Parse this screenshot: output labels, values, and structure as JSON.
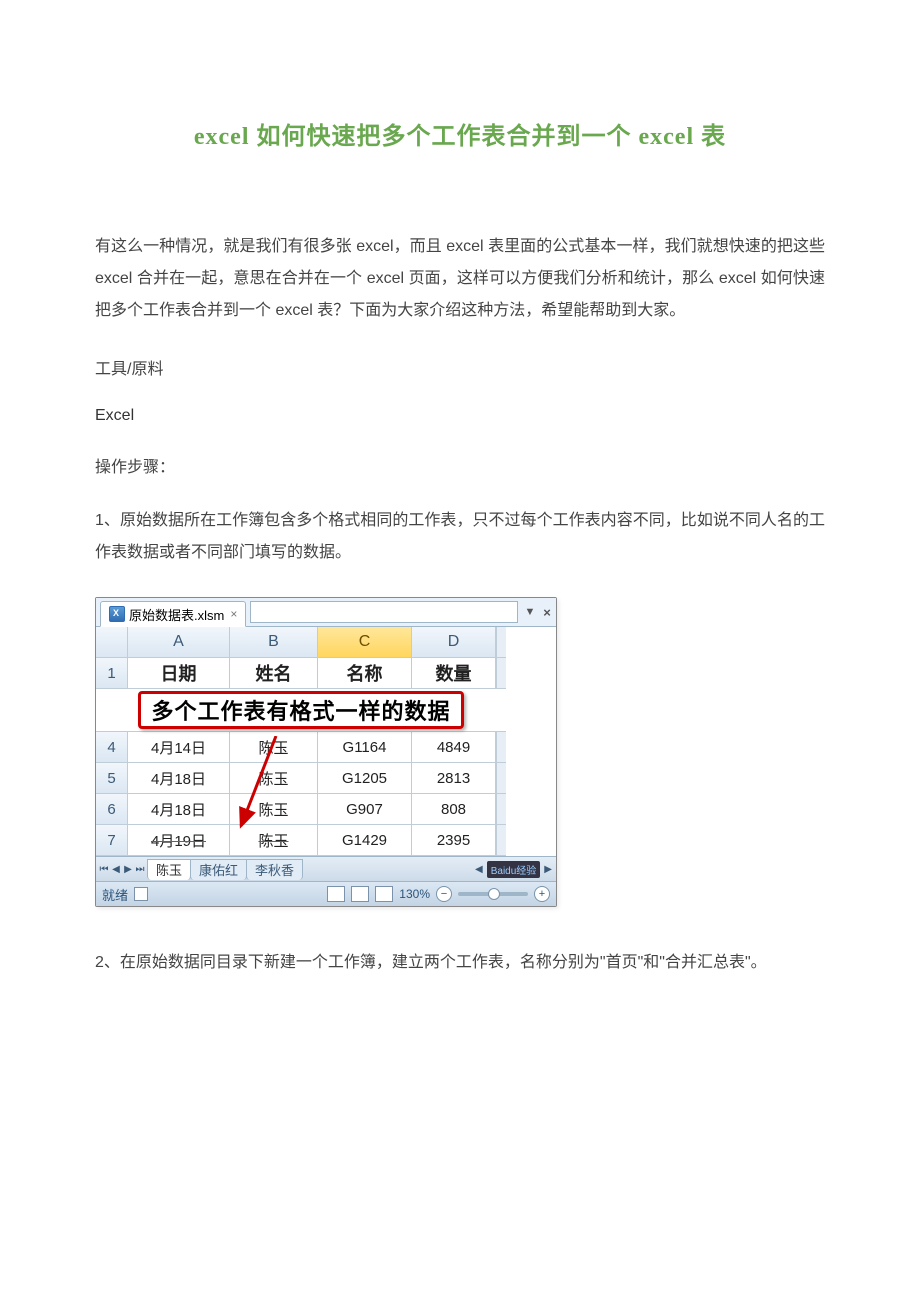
{
  "title": "excel 如何快速把多个工作表合并到一个 excel 表",
  "intro": "有这么一种情况，就是我们有很多张 excel，而且 excel 表里面的公式基本一样，我们就想快速的把这些 excel 合并在一起，意思在合并在一个 excel 页面，这样可以方便我们分析和统计，那么 excel 如何快速把多个工作表合并到一个 excel 表？下面为大家介绍这种方法，希望能帮助到大家。",
  "tools_label": "工具/原料",
  "tool_item": "Excel",
  "steps_label": "操作步骤：",
  "step1": "1、原始数据所在工作簿包含多个格式相同的工作表，只不过每个工作表内容不同，比如说不同人名的工作表数据或者不同部门填写的数据。",
  "step2": "2、在原始数据同目录下新建一个工作簿，建立两个工作表，名称分别为\"首页\"和\"合并汇总表\"。",
  "excel": {
    "filename": "原始数据表.xlsm",
    "columns": [
      "A",
      "B",
      "C",
      "D"
    ],
    "header_row_num": "1",
    "headers": [
      "日期",
      "姓名",
      "名称",
      "数量"
    ],
    "banner": "多个工作表有格式一样的数据",
    "row_nums": [
      "4",
      "5",
      "6",
      "7"
    ],
    "rows": [
      [
        "4月14日",
        "陈玉",
        "G1164",
        "4849"
      ],
      [
        "4月18日",
        "陈玉",
        "G1205",
        "2813"
      ],
      [
        "4月18日",
        "陈玉",
        "G907",
        "808"
      ],
      [
        "4月19日",
        "陈玉",
        "G1429",
        "2395"
      ]
    ],
    "sheet_tabs": [
      "陈玉",
      "康佑红",
      "李秋香"
    ],
    "status_ready": "就绪",
    "zoom": "130%",
    "baidu": "Baidu经验"
  }
}
